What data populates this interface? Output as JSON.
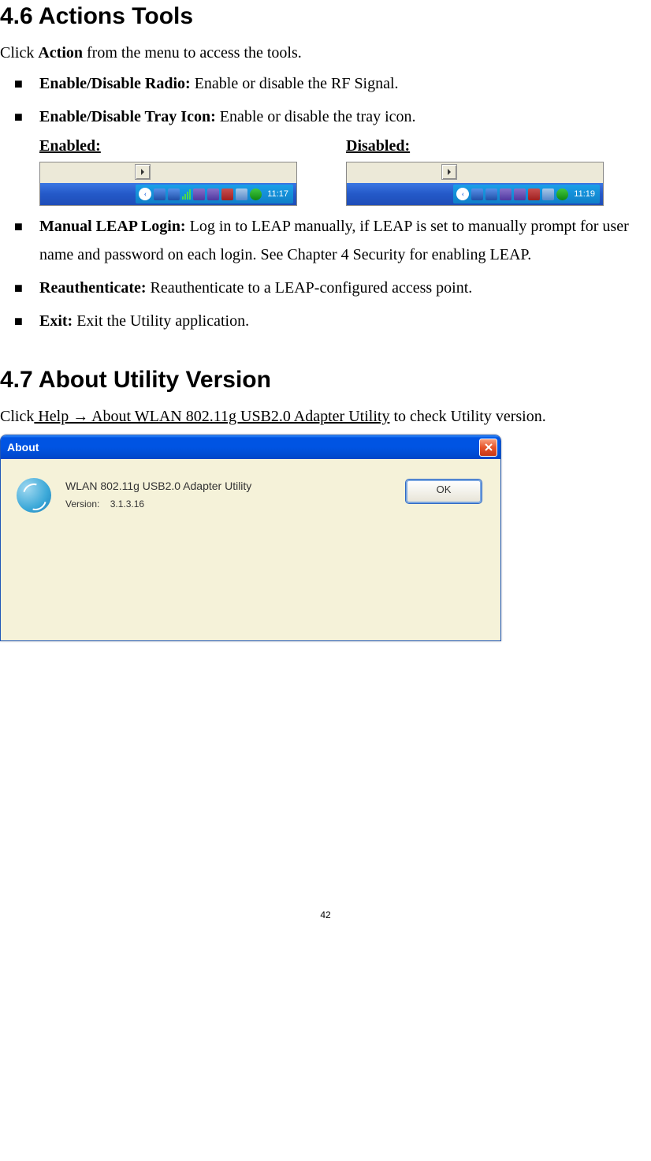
{
  "section1": {
    "heading": "4.6 Actions Tools",
    "intro_prefix": "Click ",
    "intro_bold": "Action",
    "intro_suffix": " from the menu to access the tools.",
    "items": [
      {
        "bold": "Enable/Disable Radio: ",
        "text": "Enable or disable the RF Signal."
      },
      {
        "bold": "Enable/Disable Tray Icon: ",
        "text": "Enable or disable the tray icon."
      }
    ],
    "enabled_label": "Enabled:",
    "disabled_label": "Disabled:",
    "enabled_time": "11:17",
    "disabled_time": "11:19",
    "items2": [
      {
        "bold": "Manual LEAP Login: ",
        "text": "Log in to LEAP manually, if LEAP is set to manually prompt for user name and password on each login. See Chapter 4 Security for enabling LEAP."
      },
      {
        "bold": "Reauthenticate: ",
        "text": "Reauthenticate to a LEAP-configured access point."
      },
      {
        "bold": "Exit: ",
        "text": "Exit the Utility application."
      }
    ]
  },
  "section2": {
    "heading": "4.7 About Utility Version",
    "intro_prefix": "Click",
    "intro_underline": " Help → About WLAN 802.11g USB2.0 Adapter Utility",
    "intro_suffix": " to check Utility version."
  },
  "about_dialog": {
    "title": "About",
    "app_name": "WLAN 802.11g USB2.0 Adapter Utility",
    "version_label": "Version:",
    "version_value": "3.1.3.16",
    "ok_label": "OK"
  },
  "page_number": "42"
}
